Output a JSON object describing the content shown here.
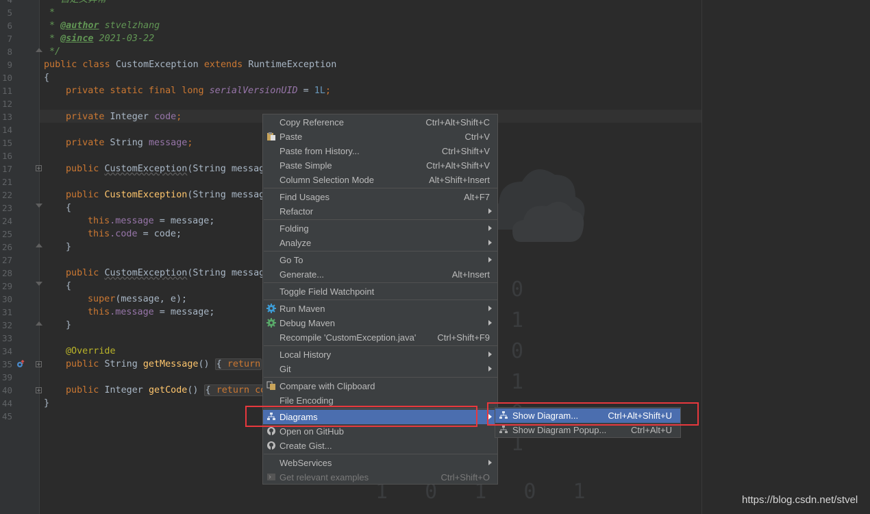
{
  "editor": {
    "line_numbers": [
      "4",
      "5",
      "6",
      "7",
      "8",
      "9",
      "10",
      "11",
      "12",
      "13",
      "14",
      "15",
      "16",
      "17",
      "21",
      "22",
      "23",
      "24",
      "25",
      "26",
      "27",
      "28",
      "29",
      "30",
      "31",
      "32",
      "33",
      "34",
      "35",
      "39",
      "40",
      "44",
      "45"
    ],
    "lines": {
      "l4": "* 自定义异常",
      "l5": "*",
      "l6_star": "* ",
      "l6_tag": "@author",
      "l6_val": " stvelzhang",
      "l7_star": "* ",
      "l7_tag": "@since",
      "l7_val": " 2021-03-22",
      "l8": "*/",
      "l9_kw1": "public class ",
      "l9_cls": "CustomException ",
      "l9_kw2": "extends ",
      "l9_cls2": "RuntimeException",
      "l10": "{",
      "l11_kw": "private static final long ",
      "l11_fld": "serialVersionUID",
      "l11_eq": " = ",
      "l11_num": "1L",
      "l11_end": ";",
      "l13_kw": "private ",
      "l13_type": "Integer ",
      "l13_fld": "code",
      "l13_end": ";",
      "l15_kw": "private ",
      "l15_type": "String ",
      "l15_fld": "message",
      "l15_end": ";",
      "l17_kw": "public ",
      "l17_fn": "CustomException",
      "l17_rest": "(String messag",
      "l22_kw": "public ",
      "l22_fn": "CustomException",
      "l22_rest": "(String messag",
      "l23": "{",
      "l24_kw": "this",
      "l24_fld": ".message",
      "l24_rest": " = message;",
      "l25_kw": "this",
      "l25_fld": ".code",
      "l25_rest": " = code;",
      "l26": "}",
      "l28_kw": "public ",
      "l28_fn": "CustomException",
      "l28_rest": "(String messag",
      "l29": "{",
      "l30_kw": "super",
      "l30_rest": "(message, e);",
      "l31_kw": "this",
      "l31_fld": ".message",
      "l31_rest": " = message;",
      "l32": "}",
      "l34_ann": "@Override",
      "l35_kw": "public ",
      "l35_type": "String ",
      "l35_fn": "getMessage",
      "l35_paren": "() ",
      "l35_box": "{ ",
      "l35_ret": "return",
      "l40_kw": "public ",
      "l40_type": "Integer ",
      "l40_fn": "getCode",
      "l40_paren": "() ",
      "l40_box": "{ ",
      "l40_ret": "return co",
      "l44": "}"
    }
  },
  "context_menu": {
    "items": [
      {
        "label": "Copy Reference",
        "shortcut": "Ctrl+Alt+Shift+C"
      },
      {
        "label": "Paste",
        "shortcut": "Ctrl+V"
      },
      {
        "label": "Paste from History...",
        "shortcut": "Ctrl+Shift+V"
      },
      {
        "label": "Paste Simple",
        "shortcut": "Ctrl+Alt+Shift+V"
      },
      {
        "label": "Column Selection Mode",
        "shortcut": "Alt+Shift+Insert"
      },
      {
        "label": "Find Usages",
        "shortcut": "Alt+F7"
      },
      {
        "label": "Refactor",
        "shortcut": ""
      },
      {
        "label": "Folding",
        "shortcut": ""
      },
      {
        "label": "Analyze",
        "shortcut": ""
      },
      {
        "label": "Go To",
        "shortcut": ""
      },
      {
        "label": "Generate...",
        "shortcut": "Alt+Insert"
      },
      {
        "label": "Toggle Field Watchpoint",
        "shortcut": ""
      },
      {
        "label": "Run Maven",
        "shortcut": ""
      },
      {
        "label": "Debug Maven",
        "shortcut": ""
      },
      {
        "label": "Recompile 'CustomException.java'",
        "shortcut": "Ctrl+Shift+F9"
      },
      {
        "label": "Local History",
        "shortcut": ""
      },
      {
        "label": "Git",
        "shortcut": ""
      },
      {
        "label": "Compare with Clipboard",
        "shortcut": ""
      },
      {
        "label": "File Encoding",
        "shortcut": ""
      },
      {
        "label": "Diagrams",
        "shortcut": ""
      },
      {
        "label": "Open on GitHub",
        "shortcut": ""
      },
      {
        "label": "Create Gist...",
        "shortcut": ""
      },
      {
        "label": "WebServices",
        "shortcut": ""
      },
      {
        "label": "Get relevant examples",
        "shortcut": "Ctrl+Shift+O"
      }
    ]
  },
  "diagrams_submenu": {
    "items": [
      {
        "label": "Show Diagram...",
        "shortcut": "Ctrl+Alt+Shift+U"
      },
      {
        "label": "Show Diagram Popup...",
        "shortcut": "Ctrl+Alt+U"
      }
    ]
  },
  "decor": {
    "bits_col1": [
      "0",
      "1",
      "0",
      "1",
      "0",
      "1"
    ],
    "bits_row": "1 0 1 0 1",
    "watermark": "https://blog.csdn.net/stvel"
  },
  "colors": {
    "background": "#2b2b2b",
    "menu_bg": "#3c3f41",
    "selection": "#4b6eaf",
    "highlight_box": "#e8383d"
  },
  "icons": {
    "paste": "paste-icon",
    "run_maven": "gear-icon",
    "debug_maven": "gear-icon",
    "compare": "compare-clipboard-icon",
    "diagrams": "diagram-icon",
    "github": "github-icon",
    "examples": "examples-icon"
  }
}
